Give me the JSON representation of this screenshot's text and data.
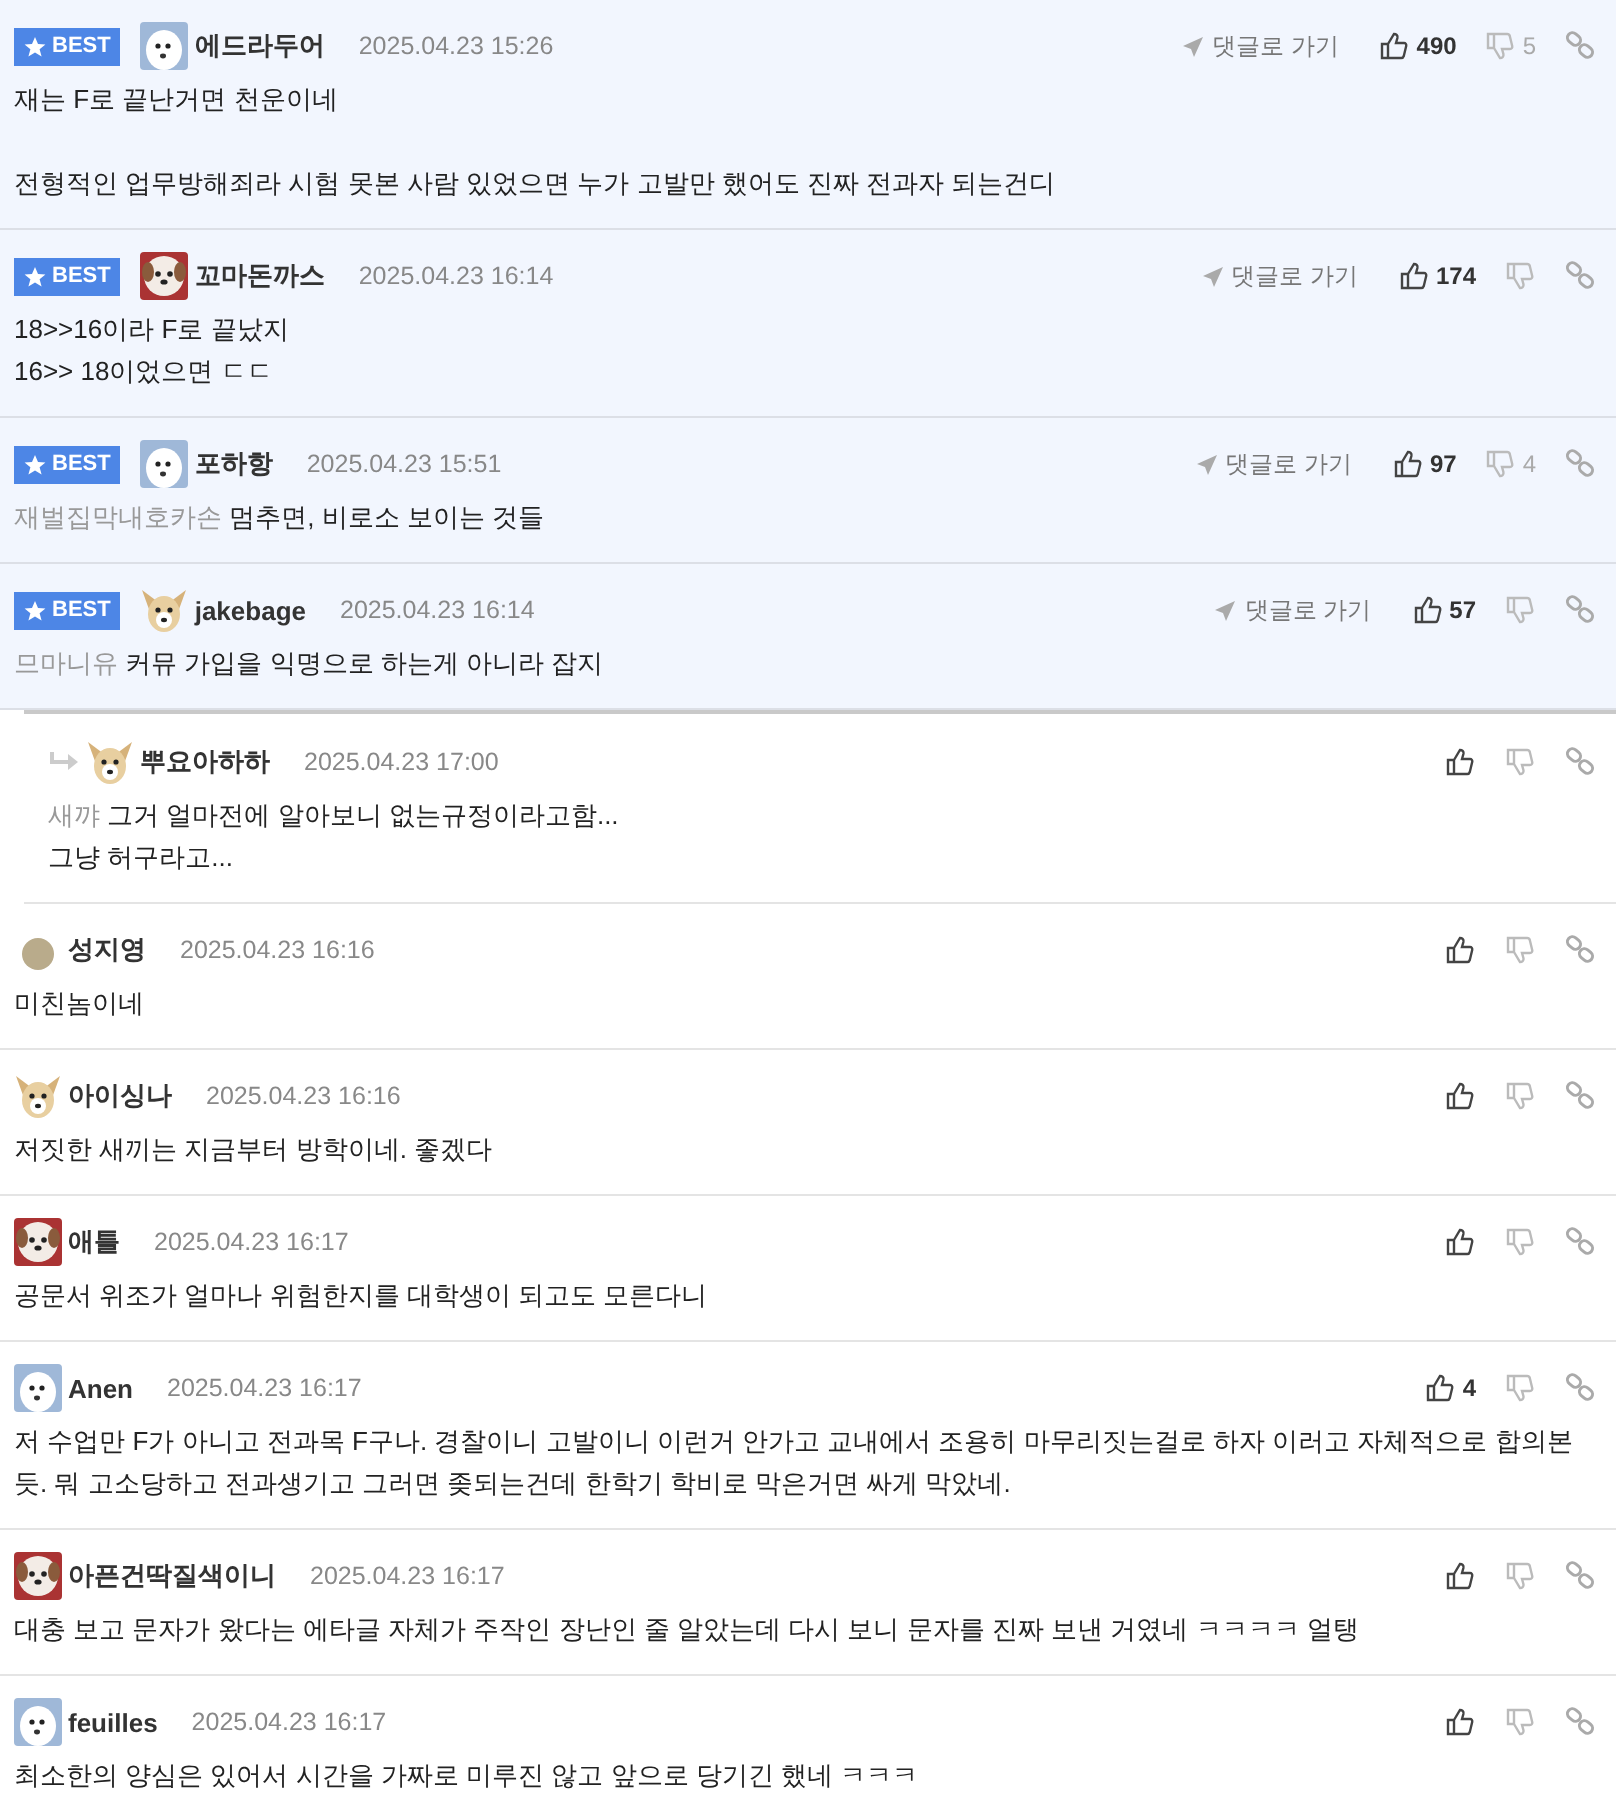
{
  "comments": [
    {
      "badge": "BEST",
      "reply": false,
      "kind": "white-dog",
      "author": "에드라두어",
      "date": "2025.04.23 15:26",
      "goto": "댓글로 가기",
      "likes": "490",
      "dislikes": "5",
      "body": "재는 F로 끝난거면 천운이네\n\n전형적인 업무방해죄라 시험 못본 사람 있었으면 누가 고발만 했어도 진짜 전과자 되는건디"
    },
    {
      "badge": "BEST",
      "reply": false,
      "kind": "puppy",
      "author": "꼬마돈까스",
      "date": "2025.04.23 16:14",
      "goto": "댓글로 가기",
      "likes": "174",
      "body": "18>>16이라 F로 끝났지\n16>> 18이었으면 ㄷㄷ"
    },
    {
      "badge": "BEST",
      "reply": false,
      "kind": "white-dog",
      "author": "포하항",
      "date": "2025.04.23 15:51",
      "goto": "댓글로 가기",
      "likes": "97",
      "dislikes": "4",
      "mention": "재벌집막내호카손",
      "body": "멈추면, 비로소 보이는 것들"
    },
    {
      "badge": "BEST",
      "reply": false,
      "kind": "chihuahua",
      "author": "jakebage",
      "date": "2025.04.23 16:14",
      "goto": "댓글로 가기",
      "likes": "57",
      "mention": "므마니유",
      "body": "커뮤 가입을 익명으로 하는게 아니라 잡지"
    },
    {
      "reply": true,
      "kind": "chihuahua",
      "author": "뿌요아하하",
      "date": "2025.04.23 17:00",
      "mention": "새꺄",
      "body": "그거 얼마전에 알아보니 없는규정이라고함...\n그냥 허구라고..."
    },
    {
      "reply": false,
      "kind": "dot",
      "author": "성지영",
      "date": "2025.04.23 16:16",
      "body": "미친놈이네"
    },
    {
      "reply": false,
      "kind": "chihuahua",
      "author": "아이싱나",
      "date": "2025.04.23 16:16",
      "body": "저짓한 새끼는 지금부터 방학이네. 좋겠다"
    },
    {
      "reply": false,
      "kind": "puppy",
      "author": "애틀",
      "date": "2025.04.23 16:17",
      "body": "공문서 위조가 얼마나 위험한지를 대학생이 되고도 모른다니"
    },
    {
      "reply": false,
      "kind": "white-dog",
      "author": "Anen",
      "date": "2025.04.23 16:17",
      "likes": "4",
      "body": "저 수업만 F가 아니고 전과목 F구나. 경찰이니 고발이니 이런거 안가고 교내에서 조용히 마무리짓는걸로 하자 이러고 자체적으로 합의본 듯. 뭐 고소당하고 전과생기고 그러면 좆되는건데 한학기 학비로 막은거면 싸게 막았네."
    },
    {
      "reply": false,
      "kind": "puppy",
      "author": "아픈건딱질색이니",
      "date": "2025.04.23 16:17",
      "body": "대충 보고 문자가 왔다는 에타글 자체가 주작인 장난인 줄 알았는데 다시 보니 문자를 진짜 보낸 거였네 ㅋㅋㅋㅋ 얼탱"
    },
    {
      "reply": false,
      "kind": "white-dog",
      "author": "feuilles",
      "date": "2025.04.23 16:17",
      "body": "최소한의 양심은 있어서 시간을 가짜로 미루진 않고 앞으로 당기긴 했네 ㅋㅋㅋ"
    }
  ]
}
